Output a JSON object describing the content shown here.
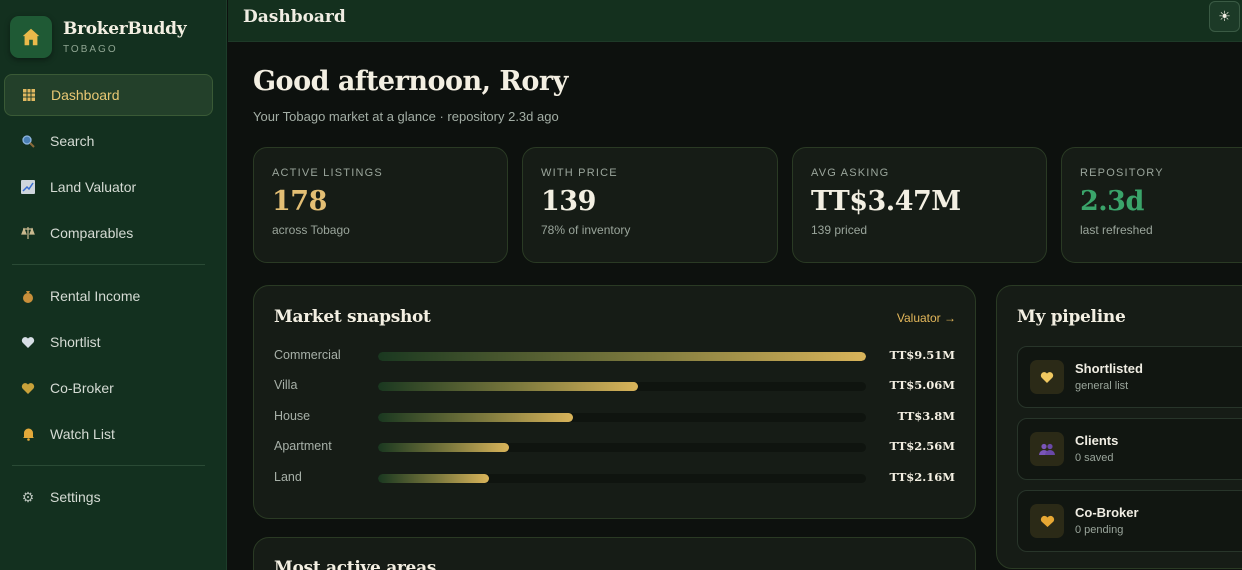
{
  "brand": {
    "name": "BrokerBuddy",
    "region": "TOBAGO"
  },
  "nav": {
    "items": [
      {
        "label": "Dashboard",
        "icon": "dashboard-grid-icon",
        "active": true
      },
      {
        "label": "Search",
        "icon": "magnifier-icon"
      },
      {
        "label": "Land Valuator",
        "icon": "chart-trend-icon"
      },
      {
        "label": "Comparables",
        "icon": "balance-scale-icon"
      },
      {
        "label": "Rental Income",
        "icon": "money-bag-icon"
      },
      {
        "label": "Shortlist",
        "icon": "heart-icon"
      },
      {
        "label": "Co-Broker",
        "icon": "handshake-icon"
      },
      {
        "label": "Watch List",
        "icon": "bell-icon"
      },
      {
        "label": "Settings",
        "icon": "gear-icon"
      }
    ]
  },
  "topbar": {
    "title": "Dashboard",
    "theme_toggle_icon": "sun-icon"
  },
  "main": {
    "greeting": "Good afternoon, Rory",
    "subtitle": "Your Tobago market at a glance · repository 2.3d ago"
  },
  "stats": [
    {
      "label": "ACTIVE LISTINGS",
      "value": "178",
      "sub": "across Tobago",
      "color": "#e3be74"
    },
    {
      "label": "WITH PRICE",
      "value": "139",
      "sub": "78% of inventory",
      "color": "#f3efe2"
    },
    {
      "label": "AVG ASKING",
      "value": "TT$3.47M",
      "sub": "139 priced",
      "color": "#f3efe2"
    },
    {
      "label": "REPOSITORY",
      "value": "2.3d",
      "sub": "last refreshed",
      "color": "#3aa46a"
    }
  ],
  "market": {
    "title": "Market snapshot",
    "link": "Valuator →",
    "rows": [
      {
        "label": "Commercial",
        "value": "TT$9.51M",
        "amount": 9.51
      },
      {
        "label": "Villa",
        "value": "TT$5.06M",
        "amount": 5.06
      },
      {
        "label": "House",
        "value": "TT$3.8M",
        "amount": 3.8
      },
      {
        "label": "Apartment",
        "value": "TT$2.56M",
        "amount": 2.56
      },
      {
        "label": "Land",
        "value": "TT$2.16M",
        "amount": 2.16
      }
    ]
  },
  "active_areas": {
    "title": "Most active areas"
  },
  "pipeline": {
    "title": "My pipeline",
    "items": [
      {
        "title": "Shortlisted",
        "sub": "general list",
        "icon": "heart-icon"
      },
      {
        "title": "Clients",
        "sub": "0 saved",
        "icon": "people-icon"
      },
      {
        "title": "Co-Broker",
        "sub": "0 pending",
        "icon": "handshake-icon"
      }
    ]
  }
}
